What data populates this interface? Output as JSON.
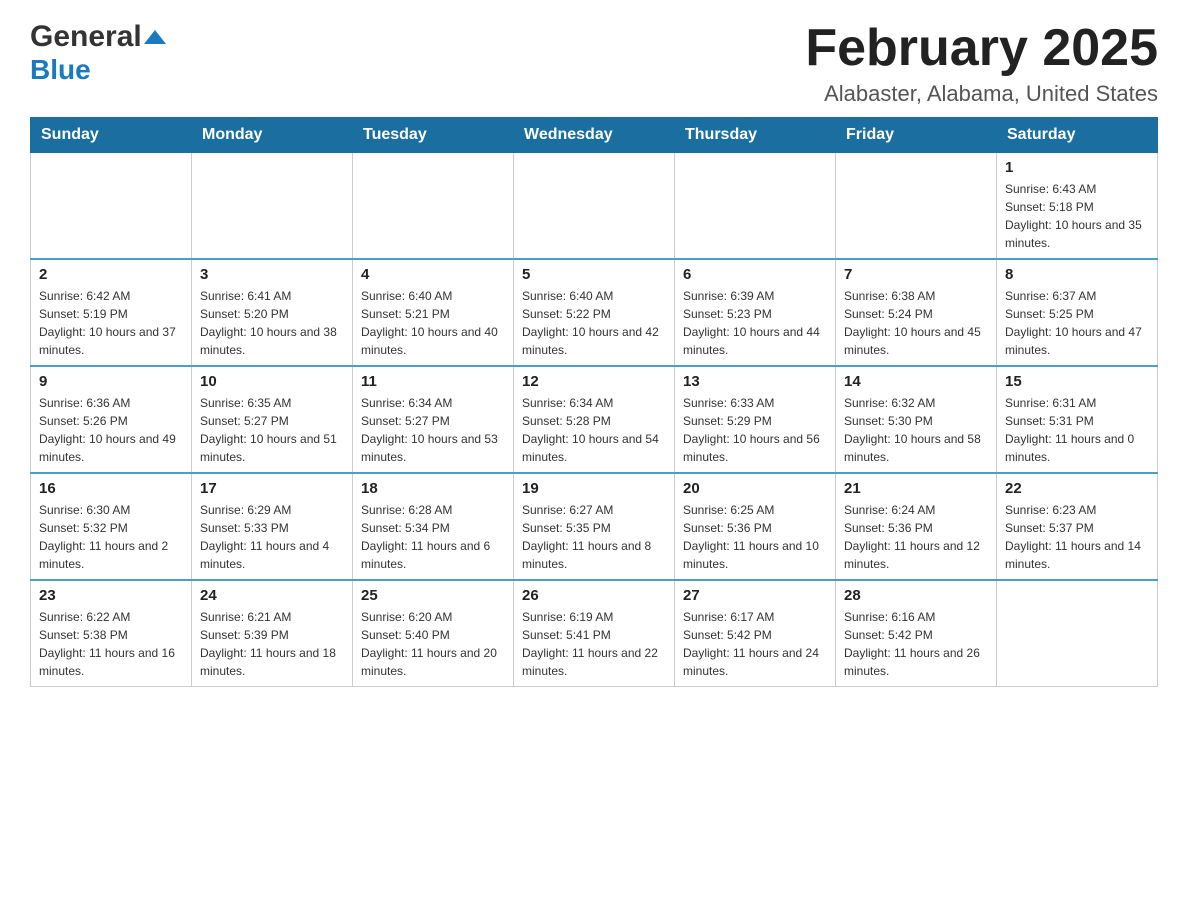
{
  "header": {
    "logo_general": "General",
    "logo_blue": "Blue",
    "month_title": "February 2025",
    "location": "Alabaster, Alabama, United States"
  },
  "days_of_week": [
    "Sunday",
    "Monday",
    "Tuesday",
    "Wednesday",
    "Thursday",
    "Friday",
    "Saturday"
  ],
  "weeks": [
    [
      {
        "day": "",
        "sunrise": "",
        "sunset": "",
        "daylight": ""
      },
      {
        "day": "",
        "sunrise": "",
        "sunset": "",
        "daylight": ""
      },
      {
        "day": "",
        "sunrise": "",
        "sunset": "",
        "daylight": ""
      },
      {
        "day": "",
        "sunrise": "",
        "sunset": "",
        "daylight": ""
      },
      {
        "day": "",
        "sunrise": "",
        "sunset": "",
        "daylight": ""
      },
      {
        "day": "",
        "sunrise": "",
        "sunset": "",
        "daylight": ""
      },
      {
        "day": "1",
        "sunrise": "Sunrise: 6:43 AM",
        "sunset": "Sunset: 5:18 PM",
        "daylight": "Daylight: 10 hours and 35 minutes."
      }
    ],
    [
      {
        "day": "2",
        "sunrise": "Sunrise: 6:42 AM",
        "sunset": "Sunset: 5:19 PM",
        "daylight": "Daylight: 10 hours and 37 minutes."
      },
      {
        "day": "3",
        "sunrise": "Sunrise: 6:41 AM",
        "sunset": "Sunset: 5:20 PM",
        "daylight": "Daylight: 10 hours and 38 minutes."
      },
      {
        "day": "4",
        "sunrise": "Sunrise: 6:40 AM",
        "sunset": "Sunset: 5:21 PM",
        "daylight": "Daylight: 10 hours and 40 minutes."
      },
      {
        "day": "5",
        "sunrise": "Sunrise: 6:40 AM",
        "sunset": "Sunset: 5:22 PM",
        "daylight": "Daylight: 10 hours and 42 minutes."
      },
      {
        "day": "6",
        "sunrise": "Sunrise: 6:39 AM",
        "sunset": "Sunset: 5:23 PM",
        "daylight": "Daylight: 10 hours and 44 minutes."
      },
      {
        "day": "7",
        "sunrise": "Sunrise: 6:38 AM",
        "sunset": "Sunset: 5:24 PM",
        "daylight": "Daylight: 10 hours and 45 minutes."
      },
      {
        "day": "8",
        "sunrise": "Sunrise: 6:37 AM",
        "sunset": "Sunset: 5:25 PM",
        "daylight": "Daylight: 10 hours and 47 minutes."
      }
    ],
    [
      {
        "day": "9",
        "sunrise": "Sunrise: 6:36 AM",
        "sunset": "Sunset: 5:26 PM",
        "daylight": "Daylight: 10 hours and 49 minutes."
      },
      {
        "day": "10",
        "sunrise": "Sunrise: 6:35 AM",
        "sunset": "Sunset: 5:27 PM",
        "daylight": "Daylight: 10 hours and 51 minutes."
      },
      {
        "day": "11",
        "sunrise": "Sunrise: 6:34 AM",
        "sunset": "Sunset: 5:27 PM",
        "daylight": "Daylight: 10 hours and 53 minutes."
      },
      {
        "day": "12",
        "sunrise": "Sunrise: 6:34 AM",
        "sunset": "Sunset: 5:28 PM",
        "daylight": "Daylight: 10 hours and 54 minutes."
      },
      {
        "day": "13",
        "sunrise": "Sunrise: 6:33 AM",
        "sunset": "Sunset: 5:29 PM",
        "daylight": "Daylight: 10 hours and 56 minutes."
      },
      {
        "day": "14",
        "sunrise": "Sunrise: 6:32 AM",
        "sunset": "Sunset: 5:30 PM",
        "daylight": "Daylight: 10 hours and 58 minutes."
      },
      {
        "day": "15",
        "sunrise": "Sunrise: 6:31 AM",
        "sunset": "Sunset: 5:31 PM",
        "daylight": "Daylight: 11 hours and 0 minutes."
      }
    ],
    [
      {
        "day": "16",
        "sunrise": "Sunrise: 6:30 AM",
        "sunset": "Sunset: 5:32 PM",
        "daylight": "Daylight: 11 hours and 2 minutes."
      },
      {
        "day": "17",
        "sunrise": "Sunrise: 6:29 AM",
        "sunset": "Sunset: 5:33 PM",
        "daylight": "Daylight: 11 hours and 4 minutes."
      },
      {
        "day": "18",
        "sunrise": "Sunrise: 6:28 AM",
        "sunset": "Sunset: 5:34 PM",
        "daylight": "Daylight: 11 hours and 6 minutes."
      },
      {
        "day": "19",
        "sunrise": "Sunrise: 6:27 AM",
        "sunset": "Sunset: 5:35 PM",
        "daylight": "Daylight: 11 hours and 8 minutes."
      },
      {
        "day": "20",
        "sunrise": "Sunrise: 6:25 AM",
        "sunset": "Sunset: 5:36 PM",
        "daylight": "Daylight: 11 hours and 10 minutes."
      },
      {
        "day": "21",
        "sunrise": "Sunrise: 6:24 AM",
        "sunset": "Sunset: 5:36 PM",
        "daylight": "Daylight: 11 hours and 12 minutes."
      },
      {
        "day": "22",
        "sunrise": "Sunrise: 6:23 AM",
        "sunset": "Sunset: 5:37 PM",
        "daylight": "Daylight: 11 hours and 14 minutes."
      }
    ],
    [
      {
        "day": "23",
        "sunrise": "Sunrise: 6:22 AM",
        "sunset": "Sunset: 5:38 PM",
        "daylight": "Daylight: 11 hours and 16 minutes."
      },
      {
        "day": "24",
        "sunrise": "Sunrise: 6:21 AM",
        "sunset": "Sunset: 5:39 PM",
        "daylight": "Daylight: 11 hours and 18 minutes."
      },
      {
        "day": "25",
        "sunrise": "Sunrise: 6:20 AM",
        "sunset": "Sunset: 5:40 PM",
        "daylight": "Daylight: 11 hours and 20 minutes."
      },
      {
        "day": "26",
        "sunrise": "Sunrise: 6:19 AM",
        "sunset": "Sunset: 5:41 PM",
        "daylight": "Daylight: 11 hours and 22 minutes."
      },
      {
        "day": "27",
        "sunrise": "Sunrise: 6:17 AM",
        "sunset": "Sunset: 5:42 PM",
        "daylight": "Daylight: 11 hours and 24 minutes."
      },
      {
        "day": "28",
        "sunrise": "Sunrise: 6:16 AM",
        "sunset": "Sunset: 5:42 PM",
        "daylight": "Daylight: 11 hours and 26 minutes."
      },
      {
        "day": "",
        "sunrise": "",
        "sunset": "",
        "daylight": ""
      }
    ]
  ]
}
